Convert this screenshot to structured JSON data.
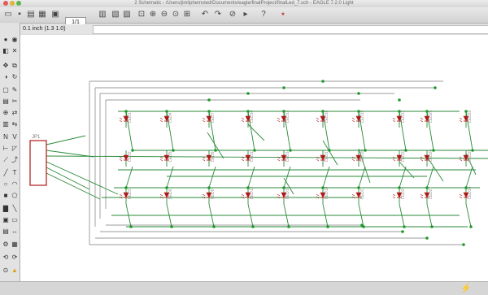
{
  "window": {
    "title": "2 Schematic - /Users/jimliphemsted/Documents/eagle/finalProject/finalLed_7.sch - EAGLE 7.2.0 Light"
  },
  "toolbar": {
    "sheet_value": "1/1"
  },
  "command": {
    "grid_readout": "0.1 inch (1.3 1.0)"
  },
  "schematic": {
    "connector_label": "JP1",
    "leds": [
      "LED1",
      "LED2",
      "LED3",
      "LED4",
      "LED5",
      "LED6",
      "LED7",
      "LED8",
      "LED9",
      "LED10",
      "LED11",
      "LED12",
      "LED13",
      "LED14",
      "LED15",
      "LED16",
      "LED17",
      "LED18",
      "LED19",
      "LED20",
      "LED21",
      "LED22",
      "LED23",
      "LED24",
      "LED25",
      "LED26",
      "LED27",
      "LED28",
      "LED29",
      "LED30"
    ]
  },
  "colors": {
    "wire": "#2a8a3a",
    "junction": "#1e9a2a",
    "part": "#b01818",
    "frame": "#7a7a7a"
  },
  "icons": {
    "status": "lightning-icon"
  }
}
